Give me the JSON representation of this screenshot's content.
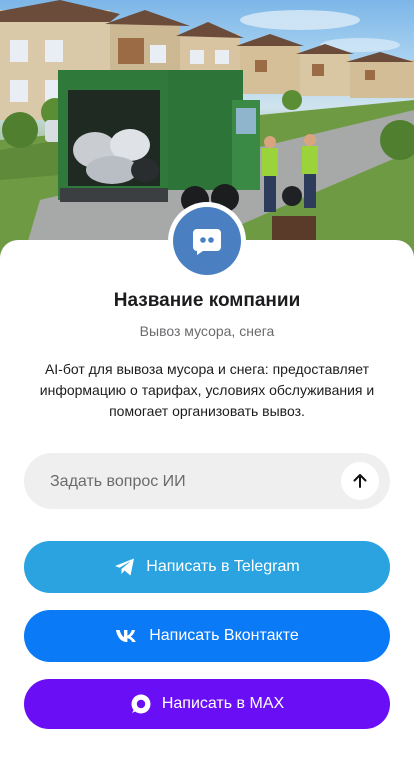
{
  "header": {
    "hero_image": "garbage-truck-suburb-scene",
    "avatar_icon": "chat-bubble-icon",
    "avatar_color": "#4a80c2"
  },
  "company": {
    "name": "Название компании",
    "subtitle": "Вывоз мусора, снега",
    "description": "AI-бот для вывоза мусора и снега: предоставляет информацию о тарифах, условиях обслуживания и помогает организовать вывоз."
  },
  "ask": {
    "placeholder": "Задать вопрос ИИ",
    "send_icon": "arrow-up-icon"
  },
  "buttons": {
    "telegram": {
      "label": "Написать в Telegram",
      "icon": "telegram-icon",
      "color": "#2aa3e0"
    },
    "vk": {
      "label": "Написать Вконтакте",
      "icon": "vk-icon",
      "color": "#0a7af7"
    },
    "max": {
      "label": "Написать в MAX",
      "icon": "max-icon",
      "color": "#6a0ef5"
    }
  }
}
